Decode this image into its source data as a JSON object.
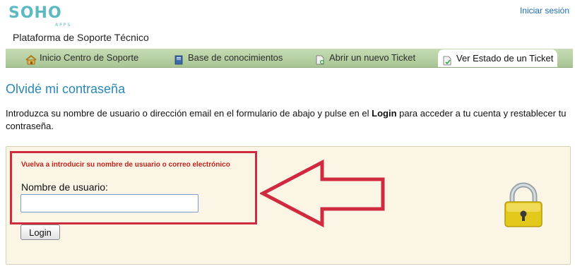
{
  "header": {
    "logo_text": "SOHO",
    "logo_sub": "APPS",
    "site_title": "Plataforma de Soporte Técnico",
    "signin_label": "Iniciar sesión"
  },
  "nav": {
    "items": [
      {
        "label": "Inicio Centro de Soporte",
        "icon": "home-icon"
      },
      {
        "label": "Base de conocimientos",
        "icon": "book-icon"
      },
      {
        "label": "Abrir un nuevo Ticket",
        "icon": "new-ticket-icon"
      },
      {
        "label": "Ver Estado de un Ticket",
        "icon": "ticket-status-icon",
        "active": true
      }
    ]
  },
  "main": {
    "title": "Olvidé mi contraseña",
    "intro_before": "Introduzca su nombre de usuario o dirección email en el formulario de abajo y pulse en el ",
    "intro_bold": "Login",
    "intro_after": " para acceder a tu cuenta y restablecer tu contraseña."
  },
  "form": {
    "error_message": "Vuelva a introducir su nombre de usuario o correo electrónico",
    "username_label": "Nombre de usuario:",
    "username_value": "",
    "username_placeholder": "",
    "login_button": "Login"
  },
  "colors": {
    "accent": "#2a87b8",
    "nav_bg": "#b8d3a4",
    "highlight": "#cf2a3e",
    "error": "#c4221b",
    "form_bg": "#fbf5e6",
    "lock": "#e3c91b"
  }
}
